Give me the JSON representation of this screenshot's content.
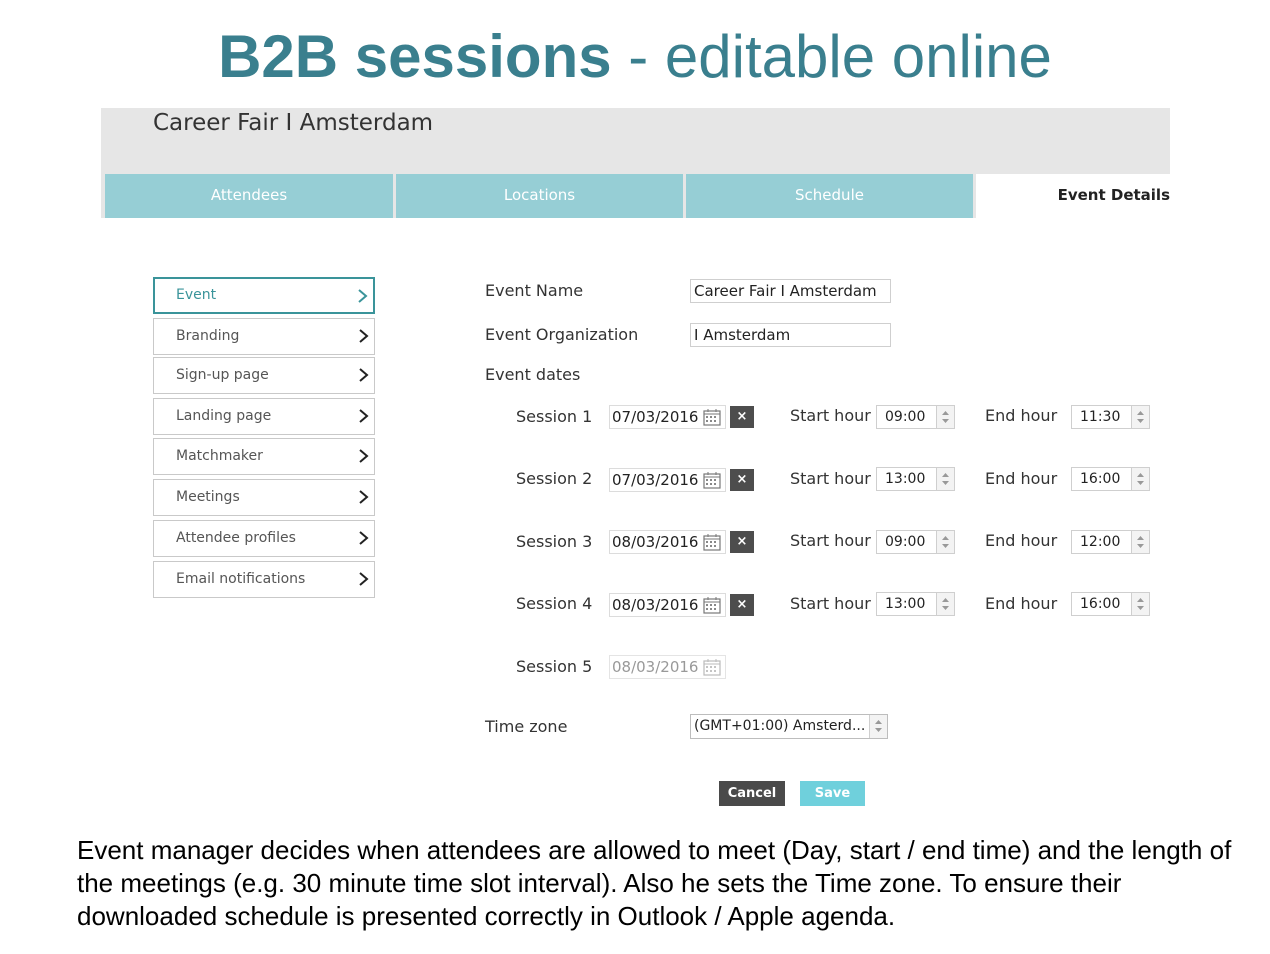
{
  "slide": {
    "title_bold": "B2B sessions",
    "title_rest": " - editable online",
    "caption": "Event manager decides when attendees are allowed to meet (Day, start / end time) and the length of the meetings (e.g. 30 minute time slot interval). Also he sets the Time zone. To ensure their downloaded schedule is presented correctly in Outlook / Apple agenda."
  },
  "app": {
    "title": "Career Fair I Amsterdam"
  },
  "tabs": [
    {
      "label": "Attendees"
    },
    {
      "label": "Locations"
    },
    {
      "label": "Schedule"
    },
    {
      "label": "Event Details",
      "active": true
    }
  ],
  "sidebar": {
    "items": [
      {
        "label": "Event",
        "active": true
      },
      {
        "label": "Branding"
      },
      {
        "label": "Sign-up page"
      },
      {
        "label": "Landing page"
      },
      {
        "label": "Matchmaker"
      },
      {
        "label": "Meetings"
      },
      {
        "label": "Attendee profiles"
      },
      {
        "label": "Email notifications"
      }
    ],
    "icon": "chevron-right-icon"
  },
  "form": {
    "event_name_label": "Event Name",
    "event_name_value": "Career Fair I Amsterdam",
    "event_org_label": "Event Organization",
    "event_org_value": "I Amsterdam",
    "event_dates_label": "Event dates",
    "start_hour_label": "Start hour",
    "end_hour_label": "End hour",
    "sessions": [
      {
        "label": "Session 1",
        "date": "07/03/2016",
        "start": "09:00",
        "end": "11:30"
      },
      {
        "label": "Session 2",
        "date": "07/03/2016",
        "start": "13:00",
        "end": "16:00"
      },
      {
        "label": "Session 3",
        "date": "08/03/2016",
        "start": "09:00",
        "end": "12:00"
      },
      {
        "label": "Session 4",
        "date": "08/03/2016",
        "start": "13:00",
        "end": "16:00"
      },
      {
        "label": "Session 5",
        "date": "08/03/2016",
        "disabled": true
      }
    ],
    "clear_symbol": "×",
    "timezone_label": "Time zone",
    "timezone_value": "(GMT+01:00) Amsterd...",
    "cancel_label": "Cancel",
    "save_label": "Save"
  },
  "colors": {
    "title": "#3a7f8e",
    "tab": "#96ced5",
    "sidebar_active": "#3a949a",
    "save": "#6fd0dc",
    "cancel": "#4a4a4a"
  }
}
